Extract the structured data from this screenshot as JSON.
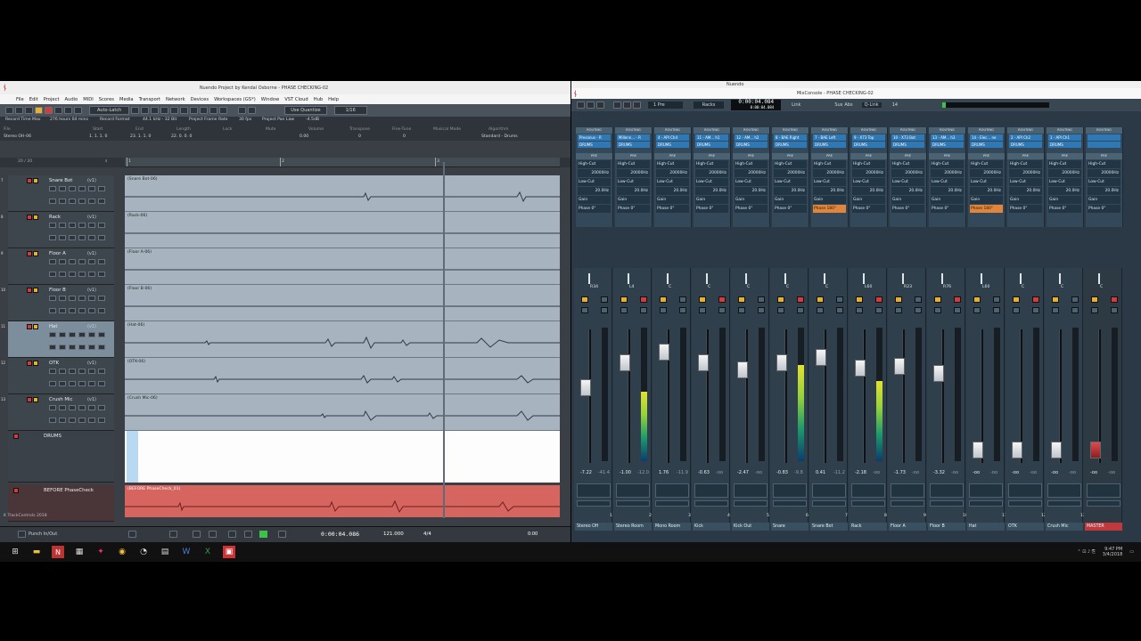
{
  "left_window": {
    "title": "Nuendo Project by Kendal Osborne - PHASE CHECKING-02",
    "menu": [
      "File",
      "Edit",
      "Project",
      "Audio",
      "MIDI",
      "Scores",
      "Media",
      "Transport",
      "Network",
      "Devices",
      "Workspaces (GS*)",
      "Window",
      "VST Cloud",
      "Hub",
      "Help"
    ],
    "toolbar": {
      "automation_mode": "Auto-Latch",
      "quantize": "Use Quantize",
      "grid": "1/16"
    },
    "infoline": {
      "record_time_label": "Record Time Max",
      "record_time": "276 hours 04 mins",
      "record_format_label": "Record Format",
      "record_format": "44.1 kHz - 32 Bit",
      "frame_rate_label": "Project Frame Rate",
      "frame_rate": "30 fps",
      "pan_law_label": "Project Pan Law",
      "pan_law": "-4.5dB",
      "col_file": "File",
      "file": "Stereo OH-06",
      "col_start": "Start",
      "start": "1. 1. 1. 0",
      "col_end": "End",
      "end": "23. 1. 1. 0",
      "col_length": "Length",
      "length": "22. 0. 0. 0",
      "col_lock": "Lock",
      "col_mute": "Mute",
      "col_volume": "Volume",
      "volume": "0.00",
      "col_transpose": "Transpose",
      "transpose": "0",
      "col_finetune": "Fine-Tune",
      "finetune": "0",
      "col_musical": "Musical Mode",
      "col_algorithm": "Algorithm",
      "algorithm": "Standard - Drums"
    },
    "track_count": "20 / 20",
    "ruler": [
      "1",
      "2",
      "3"
    ],
    "tracks": [
      {
        "num": "7",
        "name": "Snare Bot",
        "sub": "(v1)",
        "event": "(Snare Bot-06)"
      },
      {
        "num": "8",
        "name": "Rack",
        "sub": "(v1)",
        "event": "(Rack-06)"
      },
      {
        "num": "9",
        "name": "Floor A",
        "sub": "(v1)",
        "event": "(Floor A-06)"
      },
      {
        "num": "10",
        "name": "Floor B",
        "sub": "(v1)",
        "event": "(Floor B-06)"
      },
      {
        "num": "11",
        "name": "Hat",
        "sub": "(v1)",
        "event": "(Hat-06)"
      },
      {
        "num": "12",
        "name": "OTK",
        "sub": "(v1)",
        "event": "(OTK-06)"
      },
      {
        "num": "13",
        "name": "Crush Mic",
        "sub": "(v1)",
        "event": "(Crush Mic-06)"
      }
    ],
    "group_track": "DRUMS",
    "before_track": {
      "name": "BEFORE PhaseCheck",
      "event": "(BEFORE PhaseCheck_01)"
    },
    "footer": "K TrackControls 2018",
    "transport": {
      "punch": "Punch In/Out",
      "time": "0:00:04.086",
      "tempo": "121.000",
      "signature": "4/4",
      "right_time": "0:00"
    }
  },
  "right_window": {
    "app_title": "Nuendo",
    "title": "MixConsole - PHASE CHECKING-02",
    "toolbar": {
      "preset": "1 Pre",
      "racks": "Racks",
      "time": "0:00:04.084",
      "time_sub": "0:00:04.084",
      "link": "Link",
      "sus": "Sus",
      "abs": "Abs",
      "qlink": "Q-Link",
      "page": "14"
    },
    "routing_label": "ROUTING",
    "rack_inputs": [
      "Presonus - R",
      "Millenn... - R",
      "4 - API Ch4",
      "11 - AM... h1",
      "12 - AM... h2",
      "8 - BAE Right",
      "7 - BAE Left",
      "9 - X73 Top",
      "10 - X73 Bot",
      "13 - AM... h3",
      "14 - Elec... ne",
      "2 - API Ch2",
      "1 - API Ch1",
      ""
    ],
    "rack_groups": [
      "DRUMS",
      "DRUMS",
      "DRUMS",
      "DRUMS",
      "DRUMS",
      "DRUMS",
      "DRUMS",
      "DRUMS",
      "DRUMS",
      "DRUMS",
      "DRUMS",
      "DRUMS",
      "DRUMS",
      ""
    ],
    "pre_label": "PRE",
    "hicut_label": "High-Cut",
    "hicut_val": "20000Hz",
    "locut_label": "Low-Cut",
    "locut_val": "20.0Hz",
    "gain_label": "Gain",
    "phase_label": "Phase 0°",
    "phase_inv_label": "Phase 180°",
    "pan_labels": [
      "R34",
      "L4",
      "C",
      "C",
      "C",
      "C",
      "C",
      "L60",
      "R23",
      "R76",
      "L60",
      "C",
      "C",
      "C"
    ],
    "fader_values": [
      [
        "-7.22",
        "-41.4"
      ],
      [
        "-1.00",
        "-12.0"
      ],
      [
        "1.76",
        "-11.9"
      ],
      [
        "-0.63",
        "-oo"
      ],
      [
        "-2.47",
        "-oo"
      ],
      [
        "-0.83",
        "-9.8"
      ],
      [
        "0.41",
        "-11.2"
      ],
      [
        "-2.18",
        "-oo"
      ],
      [
        "-1.73",
        "-oo"
      ],
      [
        "-3.32",
        "-oo"
      ],
      [
        "-oo",
        "-oo"
      ],
      [
        "-oo",
        "-oo"
      ],
      [
        "-oo",
        "-oo"
      ],
      [
        "-oo",
        "-oo"
      ]
    ],
    "channel_numbers": [
      "1",
      "2",
      "3",
      "4",
      "5",
      "6",
      "7",
      "8",
      "9",
      "10",
      "11",
      "12",
      "13"
    ],
    "channels": [
      "Stereo OH",
      "Stereo Room",
      "Mono Room",
      "Kick",
      "Kick Out",
      "Snare",
      "Snare Bot",
      "Rack",
      "Floor A",
      "Floor B",
      "Hat",
      "OTK",
      "Crush Mic",
      "MASTER"
    ]
  },
  "taskbar": {
    "time": "9:47 PM",
    "date": "3/4/2018"
  },
  "colors": {
    "mute": "#e7b12c",
    "solo": "#d63b3b",
    "rack_blue": "#2f78b6",
    "phase_orange": "#e0853b",
    "master": "#c0393d"
  }
}
